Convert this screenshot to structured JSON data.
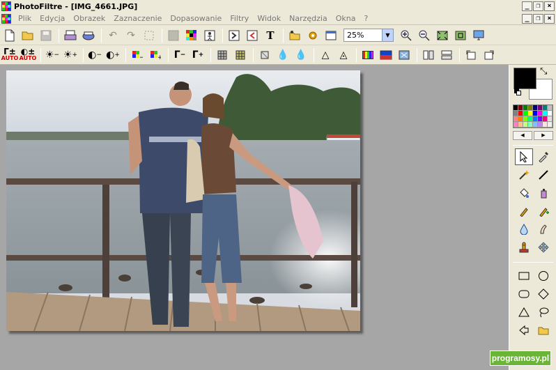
{
  "window": {
    "title": "PhotoFiltre - [IMG_4661.JPG]"
  },
  "menu": {
    "items": [
      "Plik",
      "Edycja",
      "Obrazek",
      "Zaznaczenie",
      "Dopasowanie",
      "Filtry",
      "Widok",
      "Narzędzia",
      "Okna",
      "?"
    ]
  },
  "toolbar": {
    "zoom_value": "25%",
    "text_tool_label": "T",
    "auto_label": "AUTO"
  },
  "colors": {
    "foreground": "#000000",
    "background": "#ffffff",
    "workspace": "#a6a6a6",
    "watermark": "#6ab436"
  },
  "watermark": {
    "text": "programosy.pl"
  }
}
